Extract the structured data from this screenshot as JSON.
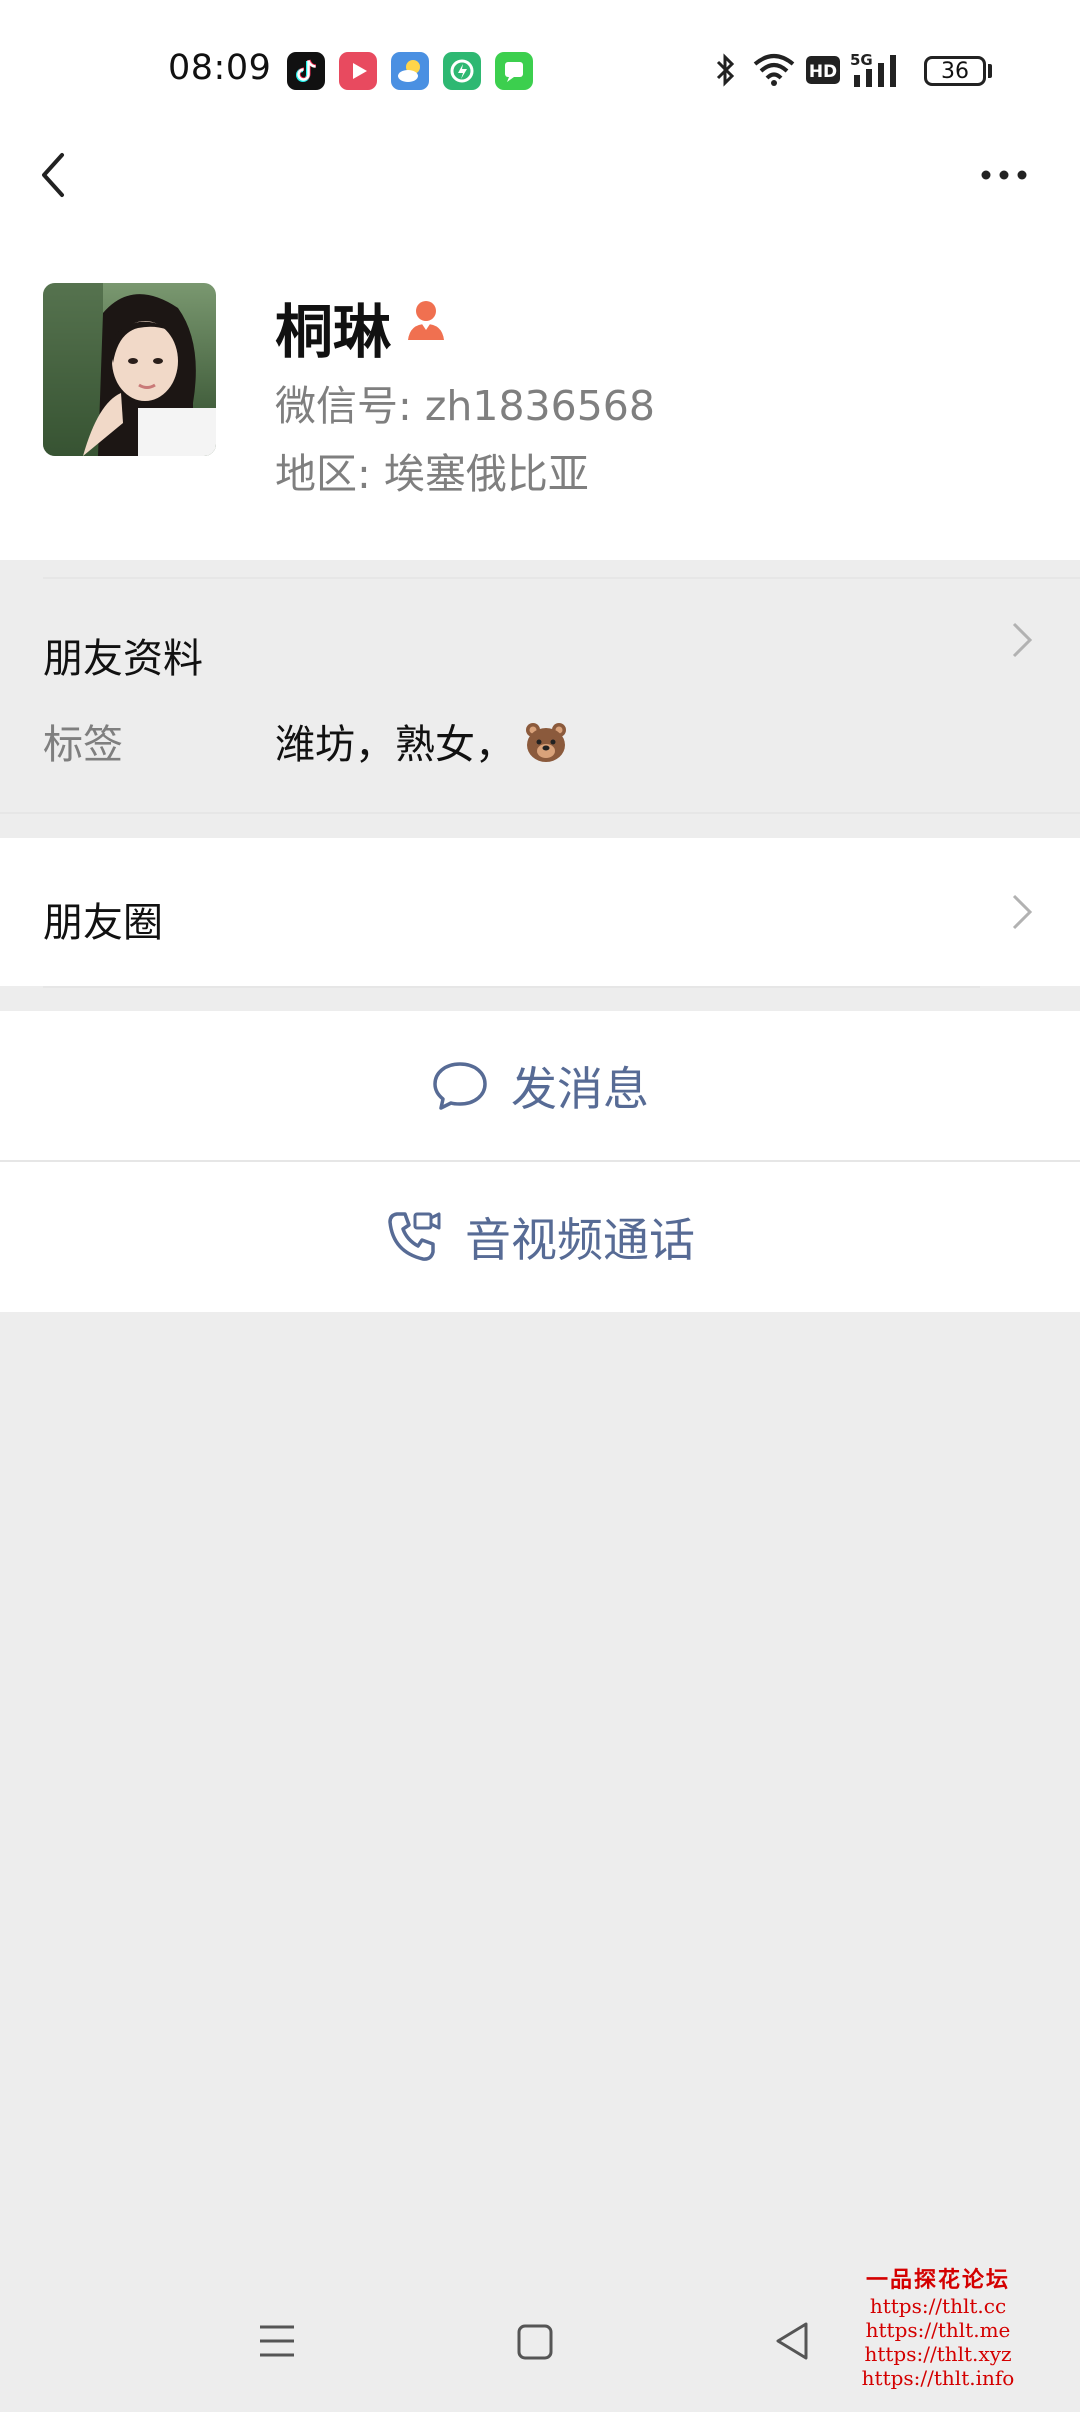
{
  "status_bar": {
    "time": "08:09",
    "app_icons": [
      "tiktok-icon",
      "video-icon",
      "weather-icon",
      "security-icon",
      "messages-icon"
    ],
    "battery": "36",
    "network": "5G"
  },
  "profile": {
    "name": "桐琳",
    "wechat_id": "微信号: zh1836568",
    "region": "地区: 埃塞俄比亚"
  },
  "friend_info": {
    "title": "朋友资料",
    "tags_label": "标签",
    "tags_value": "潍坊，熟女，"
  },
  "moments": {
    "title": "朋友圈"
  },
  "actions": {
    "message": "发消息",
    "call": "音视频通话"
  },
  "watermark": {
    "title": "一品探花论坛",
    "urls": [
      "https://thlt.cc",
      "https://thlt.me",
      "https://thlt.xyz",
      "https://thlt.info"
    ]
  },
  "colors": {
    "link": "#576b95",
    "background": "#ededed",
    "gender_badge": "#f07050"
  }
}
